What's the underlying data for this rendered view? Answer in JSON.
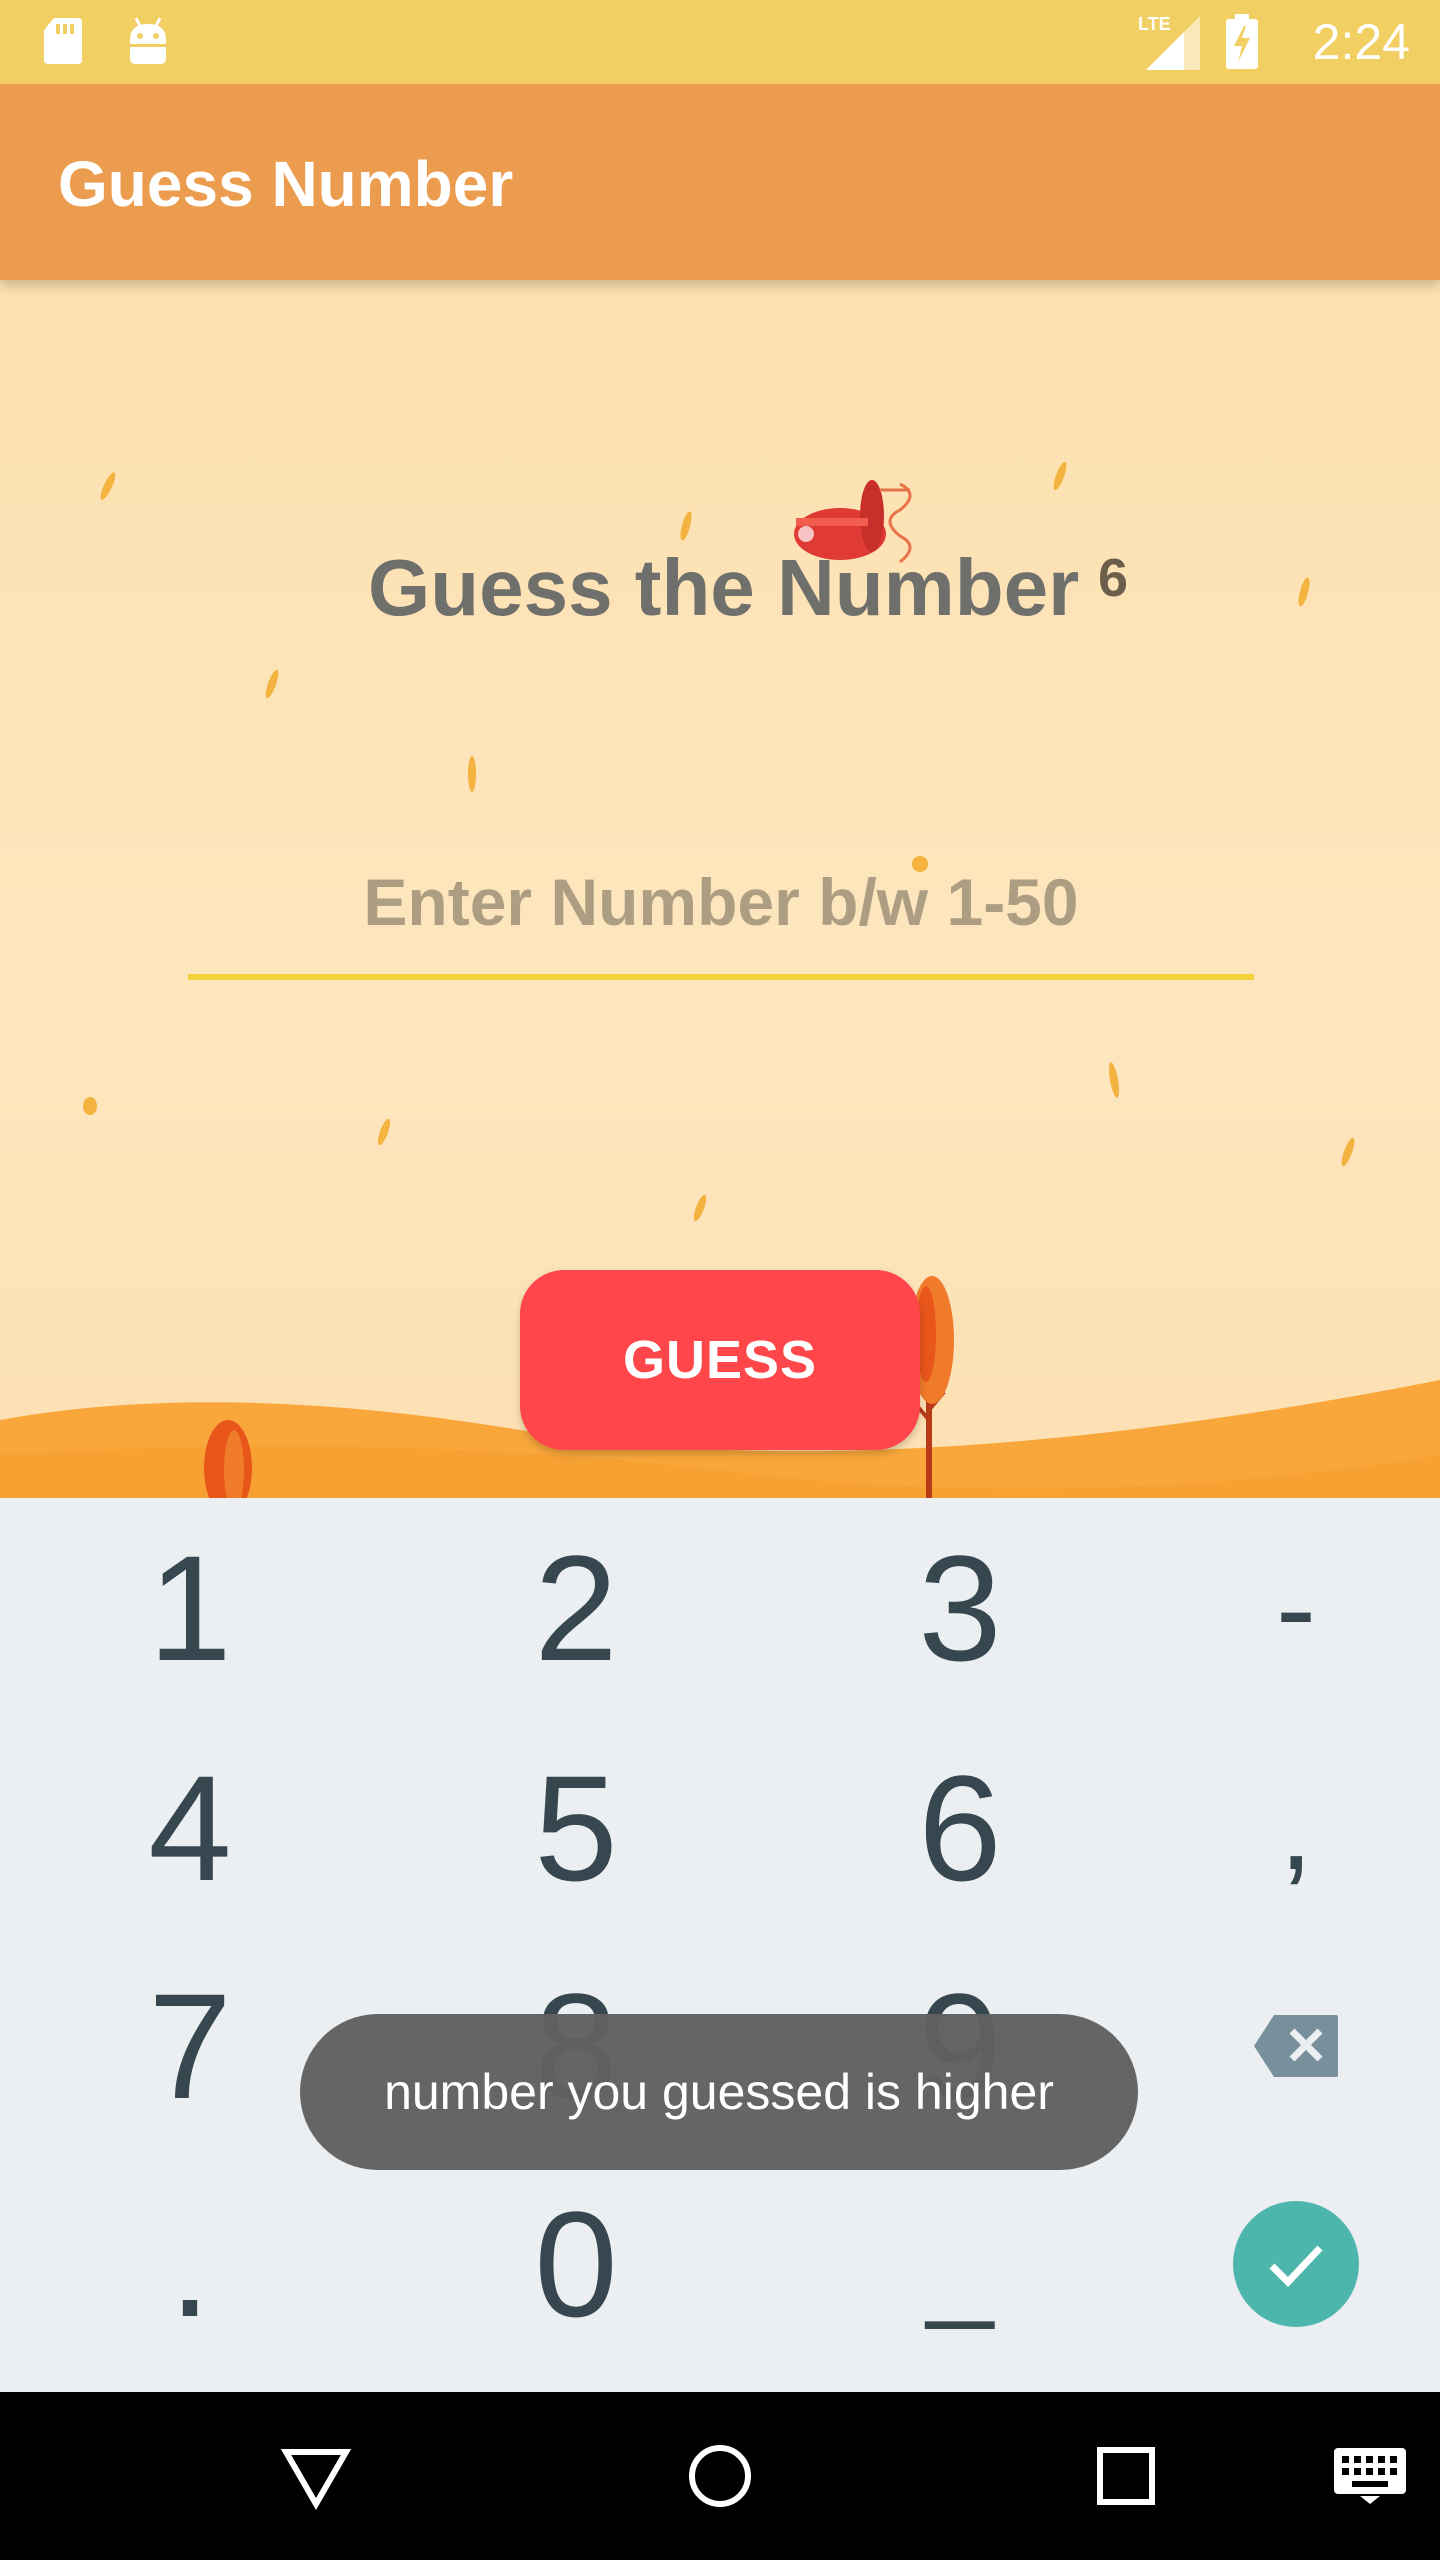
{
  "status_bar": {
    "time": "2:24",
    "network_label": "LTE",
    "icons": [
      "sd-card-icon",
      "android-icon",
      "lte-signal-icon",
      "battery-charging-icon"
    ]
  },
  "app_bar": {
    "title": "Guess Number",
    "background_color": "#ec9c4f"
  },
  "main": {
    "heading": "Guess the Number",
    "attempt_count": "6",
    "input": {
      "placeholder": "Enter Number b/w 1-50",
      "value": ""
    },
    "guess_button_label": "GUESS",
    "accent_color": "#ff464a"
  },
  "keyboard": {
    "keys": {
      "k1": "1",
      "k2": "2",
      "k3": "3",
      "minus": "-",
      "k4": "4",
      "k5": "5",
      "k6": "6",
      "comma": ",",
      "k7": "7",
      "k8": "8",
      "k9": "9",
      "dot": ".",
      "k0": "0",
      "underscore": "_"
    },
    "icons": [
      "backspace-icon",
      "done-check-icon"
    ],
    "done_color": "#4db6ac"
  },
  "toast": {
    "message": "number you guessed is higher"
  },
  "nav_bar": {
    "icons": [
      "back-icon",
      "home-icon",
      "recents-icon",
      "keyboard-switch-icon"
    ]
  }
}
